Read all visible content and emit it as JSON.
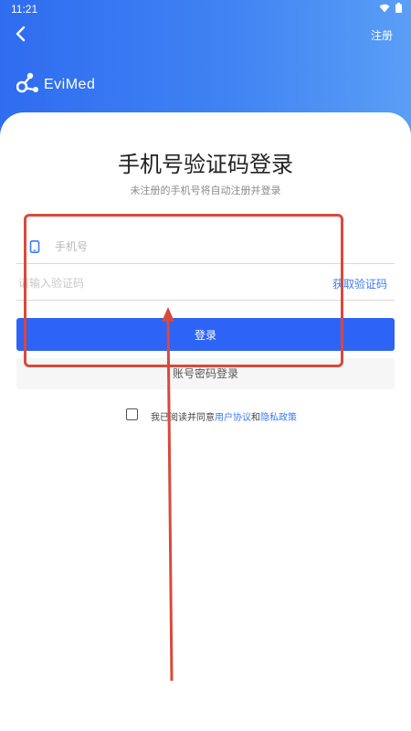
{
  "status_bar": {
    "time": "11:21",
    "icons": [
      "wifi-icon",
      "battery-icon"
    ]
  },
  "nav": {
    "back_icon": "chevron-left-icon",
    "register_label": "注册"
  },
  "brand": {
    "logo_icon": "evimed-logo-icon",
    "name": "EviMed"
  },
  "login_form": {
    "title": "手机号验证码登录",
    "subtitle": "未注册的手机号将自动注册并登录",
    "phone": {
      "icon": "mobile-phone-icon",
      "placeholder": "手机号",
      "value": ""
    },
    "code": {
      "placeholder": "请输入验证码",
      "value": "",
      "get_code_label": "获取验证码"
    },
    "login_button_label": "登录",
    "password_login_label": "账号密码登录",
    "agreement": {
      "checked": false,
      "prefix": "我已阅读并同意",
      "user_agreement": "用户协议",
      "conjunction": "和",
      "privacy_policy": "隐私政策"
    }
  },
  "annotation": {
    "box_color": "#d9493b",
    "arrow_color": "#d9493b",
    "arrow_icon": "red-arrow-up-icon"
  },
  "colors": {
    "header_gradient_start": "#2f6cf0",
    "header_gradient_end": "#5a9ef6",
    "primary": "#2e64f6",
    "link": "#3b7cf5"
  }
}
